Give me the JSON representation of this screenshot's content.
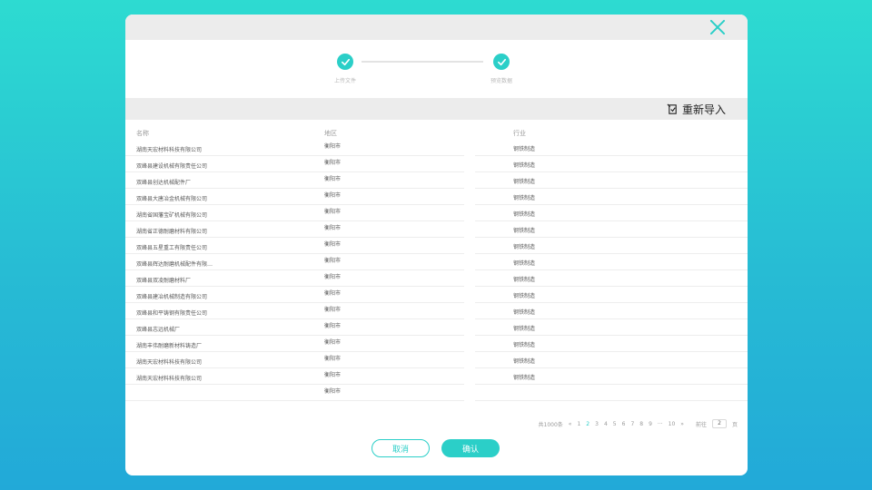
{
  "dialog": {
    "close_icon": "close-icon",
    "steps": [
      {
        "label": "上传文件"
      },
      {
        "label": "预览数据"
      }
    ],
    "reimport_label": "重新导入",
    "table": {
      "headers": {
        "name": "名称",
        "region": "地区",
        "industry": "行业"
      },
      "rows": [
        {
          "name": "湖南天宏材料科技有限公司",
          "region": "衡阳市",
          "industry": "钢铁制造"
        },
        {
          "name": "双峰县建设机械有限责任公司",
          "region": "衡阳市",
          "industry": "钢铁制造"
        },
        {
          "name": "双峰县创达机械配件厂",
          "region": "衡阳市",
          "industry": "钢铁制造"
        },
        {
          "name": "双峰县大唐冶金机械有限公司",
          "region": "衡阳市",
          "industry": "钢铁制造"
        },
        {
          "name": "湖南省国藩宝矿机械有限公司",
          "region": "衡阳市",
          "industry": "钢铁制造"
        },
        {
          "name": "湖南省正德耐磨材料有限公司",
          "region": "衡阳市",
          "industry": "钢铁制造"
        },
        {
          "name": "双峰县五星重工有限责任公司",
          "region": "衡阳市",
          "industry": "钢铁制造"
        },
        {
          "name": "双峰县辉达耐磨机械配件有限…",
          "region": "衡阳市",
          "industry": "钢铁制造"
        },
        {
          "name": "双峰县双凌耐磨材料厂",
          "region": "衡阳市",
          "industry": "钢铁制造"
        },
        {
          "name": "双峰县建冶机械制造有限公司",
          "region": "衡阳市",
          "industry": "钢铁制造"
        },
        {
          "name": "双峰县和平铸钢有限责任公司",
          "region": "衡阳市",
          "industry": "钢铁制造"
        },
        {
          "name": "双峰县志远机械厂",
          "region": "衡阳市",
          "industry": "钢铁制造"
        },
        {
          "name": "湖南丰伟耐磨新材料铸造厂",
          "region": "衡阳市",
          "industry": "钢铁制造"
        },
        {
          "name": "湖南天宏材料科技有限公司",
          "region": "衡阳市",
          "industry": "钢铁制造"
        },
        {
          "name": "湖南天宏材料科技有限公司",
          "region": "衡阳市",
          "industry": "钢铁制造"
        },
        {
          "name": "",
          "region": "衡阳市",
          "industry": ""
        }
      ]
    },
    "pagination": {
      "total": "共1000条",
      "prev": "«",
      "pages": [
        "1",
        "2",
        "3",
        "4",
        "5",
        "6",
        "7",
        "8",
        "9"
      ],
      "ellipsis": "···",
      "last": "10",
      "next": "»",
      "goto_label": "前往",
      "goto_value": "2",
      "goto_suffix": "页"
    },
    "buttons": {
      "cancel": "取消",
      "confirm": "确认"
    },
    "colors": {
      "accent": "#2bcfc8",
      "header_bg": "#ececec"
    }
  }
}
